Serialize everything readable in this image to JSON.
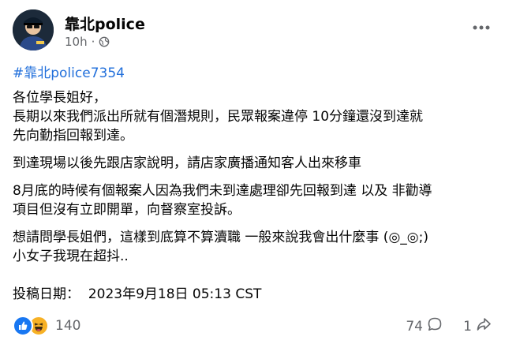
{
  "post": {
    "author": "靠北police",
    "timestamp": "10h",
    "separator": "·",
    "hashtag": "#靠北police7354",
    "paragraphs": [
      [
        "各位學長姐好，",
        "長期以來我們派出所就有個潛規則，民眾報案違停 10分鐘還沒到達就",
        "先向勤指回報到達。"
      ],
      [
        "到達現場以後先跟店家說明，請店家廣播通知客人出來移車"
      ],
      [
        "8月底的時候有個報案人因為我們未到達處理卻先回報到達 以及 非勸導",
        "項目但沒有立即開單，向督察室投訴。"
      ],
      [
        "想請問學長姐們，這樣到底算不算瀆職 一般來說我會出什麼事 (◎_◎;)",
        "小女子我現在超抖.."
      ]
    ],
    "date_line": "投稿日期：  2023年9月18日 05:13 CST"
  },
  "footer": {
    "reaction_count": "140",
    "comment_count": "74",
    "share_count": "1"
  },
  "icons": {
    "privacy": "globe-icon",
    "more": "more-options-icon",
    "like": "like-reaction-icon",
    "haha": "haha-reaction-icon",
    "comment": "comment-icon",
    "share": "share-icon"
  },
  "colors": {
    "hashtag": "#216fdb",
    "like": "#1877f2",
    "haha": "#f7b125",
    "secondary_text": "#65676b"
  }
}
